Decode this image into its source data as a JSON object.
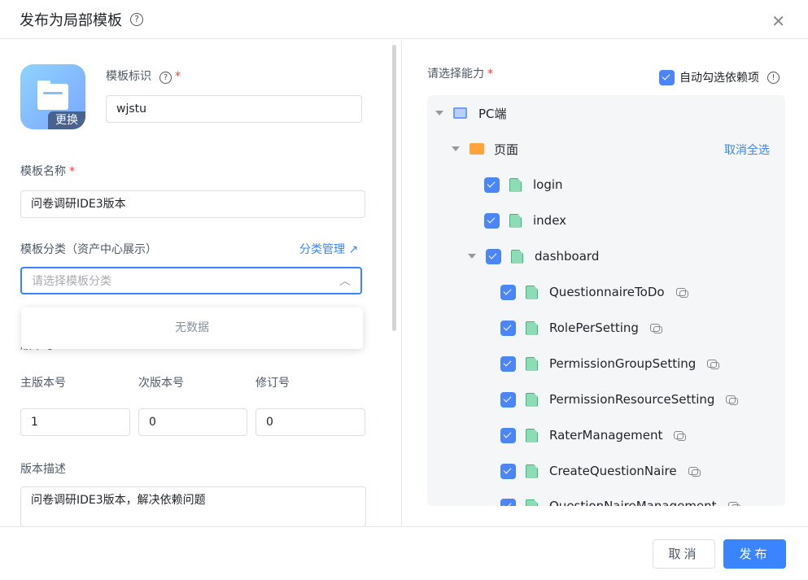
{
  "dialog": {
    "title": "发布为局部模板",
    "close_icon": "close-icon"
  },
  "left": {
    "icon_change": "更换",
    "template_id": {
      "label": "模板标识",
      "value": "wjstu"
    },
    "template_name": {
      "label": "模板名称",
      "value": "问卷调研IDE3版本"
    },
    "category": {
      "label": "模板分类（资产中心展示）",
      "manage_link": "分类管理",
      "placeholder": "请选择模板分类",
      "empty": "无数据"
    },
    "version": {
      "label": "版本号",
      "major_label": "主版本号",
      "minor_label": "次版本号",
      "patch_label": "修订号",
      "major": "1",
      "minor": "0",
      "patch": "0"
    },
    "description": {
      "label": "版本描述",
      "value": "问卷调研IDE3版本，解决依赖问题"
    }
  },
  "right": {
    "label": "请选择能力",
    "auto_select": {
      "label": "自动勾选依赖项",
      "checked": true
    },
    "tree": {
      "root": "PC端",
      "group": "页面",
      "deselect_all": "取消全选",
      "pages": [
        "login",
        "index",
        "dashboard"
      ],
      "children": [
        "QuestionnaireToDo",
        "RolePerSetting",
        "PermissionGroupSetting",
        "PermissionResourceSetting",
        "RaterManagement",
        "CreateQuestionNaire",
        "QuestionNaireManagement"
      ]
    }
  },
  "footer": {
    "cancel": "取消",
    "publish": "发布"
  },
  "colors": {
    "primary": "#3a84ff",
    "required": "#f53f3f",
    "checkbox": "#4c86f6"
  }
}
